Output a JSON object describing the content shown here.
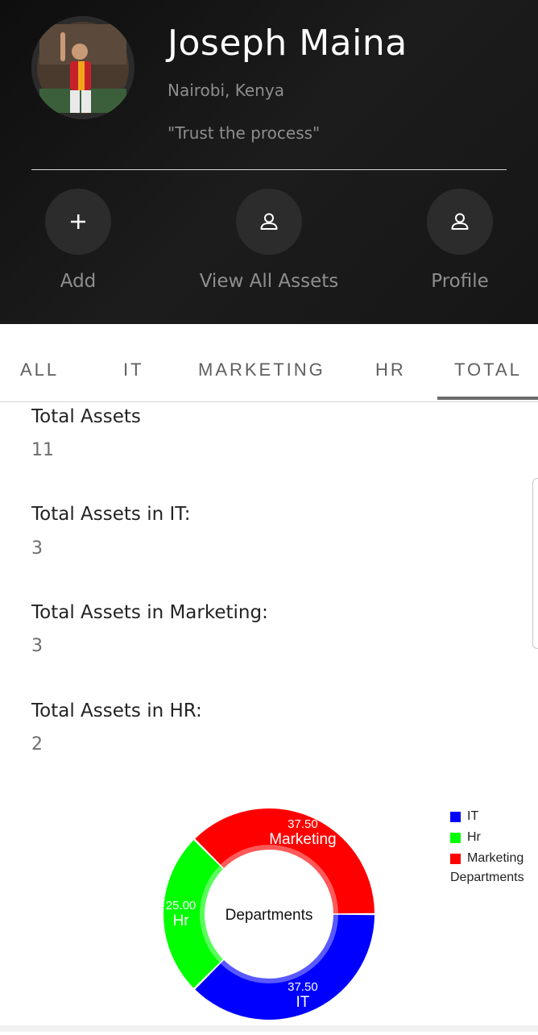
{
  "profile": {
    "name": "Joseph Maina",
    "location": "Nairobi, Kenya",
    "quote": "\"Trust the process\""
  },
  "actions": [
    {
      "label": "Add",
      "icon": "plus-icon"
    },
    {
      "label": "View All Assets",
      "icon": "person-icon"
    },
    {
      "label": "Profile",
      "icon": "person-icon"
    }
  ],
  "tabs": [
    {
      "label": "ALL"
    },
    {
      "label": "IT"
    },
    {
      "label": "MARKETING"
    },
    {
      "label": "HR"
    },
    {
      "label": "TOTAL",
      "selected": true
    }
  ],
  "stats": [
    {
      "label": "Total Assets",
      "value": "11"
    },
    {
      "label": "Total Assets in IT:",
      "value": "3"
    },
    {
      "label": "Total Assets in Marketing:",
      "value": "3"
    },
    {
      "label": "Total Assets in HR:",
      "value": "2"
    }
  ],
  "chart_data": {
    "type": "pie",
    "title": "Departments",
    "legend_title": "Departments",
    "legend_position": "top-right",
    "slices": [
      {
        "name": "IT",
        "value": 37.5,
        "label": "37.50",
        "color": "#0000ff"
      },
      {
        "name": "Hr",
        "value": 25.0,
        "label": "25.00",
        "color": "#00ff00"
      },
      {
        "name": "Marketing",
        "value": 37.5,
        "label": "37.50",
        "color": "#ff0000"
      }
    ]
  }
}
